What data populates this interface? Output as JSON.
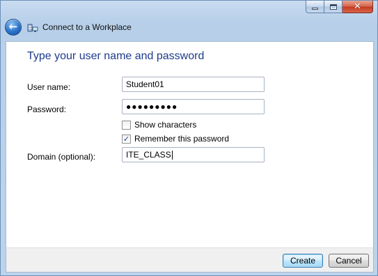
{
  "window": {
    "title": "Connect to a Workplace",
    "controls": {
      "minimize_icon": "minimize-icon",
      "maximize_icon": "maximize-icon",
      "close_glyph": "✕"
    }
  },
  "header": {
    "back_glyph": "←",
    "app_icon": "network-workplace-icon"
  },
  "content": {
    "heading": "Type your user name and password",
    "username": {
      "label": "User name:",
      "value": "Student01"
    },
    "password": {
      "label": "Password:",
      "value": "●●●●●●●●●"
    },
    "show_characters": {
      "label": "Show characters",
      "checked": false
    },
    "remember_password": {
      "label": "Remember this password",
      "checked": true,
      "mark": "✓"
    },
    "domain": {
      "label": "Domain (optional):",
      "value": "ITE_CLASS"
    }
  },
  "footer": {
    "create_label": "Create",
    "cancel_label": "Cancel"
  },
  "colors": {
    "heading": "#1e3b8c",
    "frame": "#bcd3ec",
    "footer": "#f0f0f0"
  }
}
